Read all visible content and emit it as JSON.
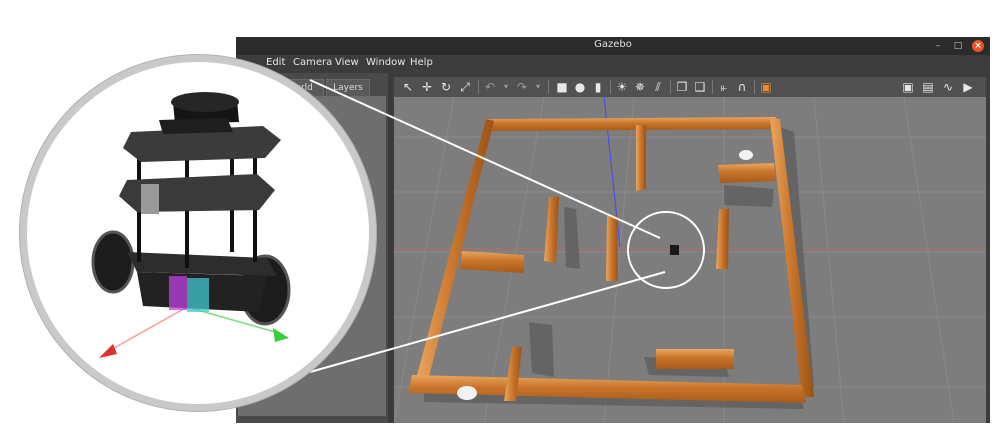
{
  "window": {
    "title": "Gazebo",
    "controls": {
      "minimize": "–",
      "maximize": "□",
      "close": "×"
    }
  },
  "menubar": {
    "items": [
      {
        "label": "Edit"
      },
      {
        "label": "Camera"
      },
      {
        "label": "View"
      },
      {
        "label": "Window"
      },
      {
        "label": "Help"
      }
    ]
  },
  "left_panel": {
    "tabs": [
      {
        "label": "World"
      },
      {
        "label": "Layers"
      }
    ]
  },
  "toolbar": {
    "left_tools": [
      "select-arrow-icon",
      "translate-icon",
      "rotate-icon",
      "scale-icon",
      "undo-icon",
      "redo-icon",
      "box-shape-icon",
      "sphere-shape-icon",
      "cylinder-shape-icon",
      "point-light-icon",
      "spot-light-icon",
      "directional-light-icon",
      "copy-icon",
      "paste-icon",
      "align-icon",
      "snap-icon",
      "change-view-icon"
    ],
    "right_tools": [
      "screenshot-icon",
      "log-icon",
      "plot-icon",
      "video-record-icon"
    ]
  },
  "colors": {
    "wall": "#c8742a",
    "wall_highlight": "#e9a35e",
    "ground": "#7d7d7d",
    "grid": "#8c8c8c",
    "accent_close": "#e95420"
  }
}
